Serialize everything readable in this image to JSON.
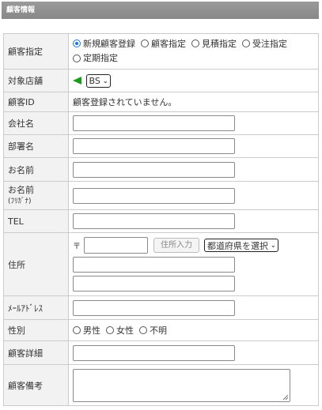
{
  "header": {
    "title": "顧客情報"
  },
  "rows": {
    "customer_select": {
      "label": "顧客指定",
      "options": [
        "新規顧客登録",
        "顧客指定",
        "見積指定",
        "受注指定",
        "定期指定"
      ],
      "selected": "新規顧客登録"
    },
    "store": {
      "label": "対象店舗",
      "flag_icon": "green-flag-icon",
      "flag_color": "#1a9b1a",
      "value": "BS"
    },
    "customer_id": {
      "label": "顧客ID",
      "value": "顧客登録されていません。"
    },
    "company": {
      "label": "会社名",
      "value": ""
    },
    "department": {
      "label": "部署名",
      "value": ""
    },
    "name": {
      "label": "お名前",
      "value": ""
    },
    "name_kana": {
      "label": "お名前",
      "label_sub": "(ﾌﾘｶﾞﾅ)",
      "value": ""
    },
    "tel": {
      "label": "TEL",
      "value": ""
    },
    "address": {
      "label": "住所",
      "postal_mark": "〒",
      "postal_value": "",
      "lookup_button": "住所入力",
      "prefecture": "都道府県を選択",
      "line1": "",
      "line2": ""
    },
    "email": {
      "label": "ﾒｰﾙｱﾄﾞﾚｽ",
      "value": ""
    },
    "gender": {
      "label": "性別",
      "options": [
        "男性",
        "女性",
        "不明"
      ]
    },
    "detail": {
      "label": "顧客詳細",
      "value": ""
    },
    "remarks": {
      "label": "顧客備考",
      "value": ""
    }
  }
}
